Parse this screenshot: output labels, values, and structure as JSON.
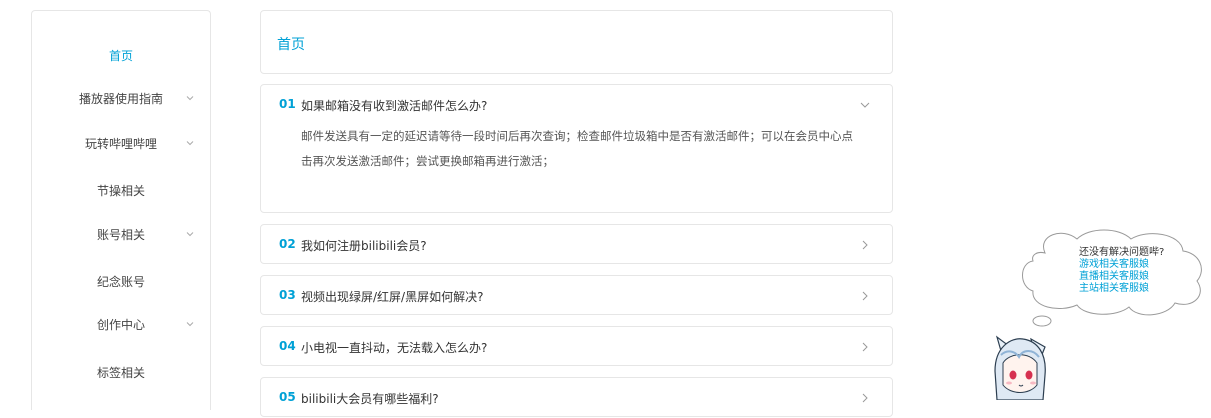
{
  "sidebar": {
    "items": [
      {
        "label": "首页",
        "active": true,
        "has_submenu": false
      },
      {
        "label": "播放器使用指南",
        "active": false,
        "has_submenu": true
      },
      {
        "label": "玩转哔哩哔哩",
        "active": false,
        "has_submenu": true
      },
      {
        "label": "节操相关",
        "active": false,
        "has_submenu": false
      },
      {
        "label": "账号相关",
        "active": false,
        "has_submenu": true
      },
      {
        "label": "纪念账号",
        "active": false,
        "has_submenu": false
      },
      {
        "label": "创作中心",
        "active": false,
        "has_submenu": true
      },
      {
        "label": "标签相关",
        "active": false,
        "has_submenu": false
      }
    ]
  },
  "breadcrumb": {
    "current": "首页"
  },
  "faq": [
    {
      "num": "01",
      "question": "如果邮箱没有收到激活邮件怎么办?",
      "expanded": true,
      "answer": "邮件发送具有一定的延迟请等待一段时间后再次查询；检查邮件垃圾箱中是否有激活邮件；可以在会员中心点击再次发送激活邮件；尝试更换邮箱再进行激活；"
    },
    {
      "num": "02",
      "question": "我如何注册bilibili会员?",
      "expanded": false
    },
    {
      "num": "03",
      "question": "视频出现绿屏/红屏/黑屏如何解决?",
      "expanded": false
    },
    {
      "num": "04",
      "question": "小电视一直抖动，无法载入怎么办?",
      "expanded": false
    },
    {
      "num": "05",
      "question": "bilibili大会员有哪些福利?",
      "expanded": false
    }
  ],
  "help_bubble": {
    "heading": "还没有解决问题哔?",
    "links": [
      "游戏相关客服娘",
      "直播相关客服娘",
      "主站相关客服娘"
    ]
  },
  "colors": {
    "accent": "#00a1d6",
    "border": "#e6e6e6",
    "text": "#333333"
  }
}
